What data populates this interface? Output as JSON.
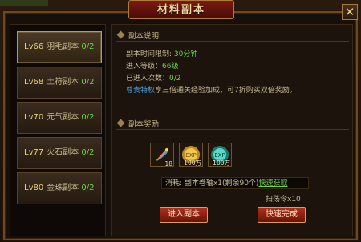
{
  "window": {
    "title": "材料副本",
    "close_label": "✕"
  },
  "levels": [
    {
      "lv": "Lv66",
      "name": "羽毛副本",
      "count": "0/2",
      "active": true
    },
    {
      "lv": "Lv68",
      "name": "土符副本",
      "count": "0/2",
      "active": false
    },
    {
      "lv": "Lv70",
      "name": "元气副本",
      "count": "0/2",
      "active": false
    },
    {
      "lv": "Lv77",
      "name": "火石副本",
      "count": "0/2",
      "active": false
    },
    {
      "lv": "Lv80",
      "name": "金珠副本",
      "count": "0/2",
      "active": false
    }
  ],
  "info": {
    "header": "副本说明",
    "time_label": "副本时间限制: ",
    "time_value": "30分钟",
    "level_label": "进入等级：",
    "level_value": "66级",
    "entered_label": "已进入次数：",
    "entered_value": "0/2",
    "privilege_link": "尊贵特权",
    "privilege_text": "享三倍通关经验加成，可7折购买双倍奖励。"
  },
  "rewards": {
    "header": "副本奖励",
    "items": [
      {
        "icon": "feather-icon",
        "qty": "18"
      },
      {
        "icon": "exp-orb-gold-icon",
        "qty": "100万"
      },
      {
        "icon": "exp-orb-teal-icon",
        "qty": "100万"
      }
    ]
  },
  "cost": {
    "label": "消耗: ",
    "item": "副本卷轴x1",
    "remaining": "(剩余90个)",
    "quick_get": "快速获取"
  },
  "sweep": {
    "text": "扫荡令x10"
  },
  "buttons": {
    "enter": "进入副本",
    "quick_complete": "快速完成"
  },
  "colors": {
    "highlight_green": "#6fd64a",
    "link_blue": "#4aa4e8",
    "level_yellow": "#e8d178",
    "button_red": "#b2301a"
  }
}
